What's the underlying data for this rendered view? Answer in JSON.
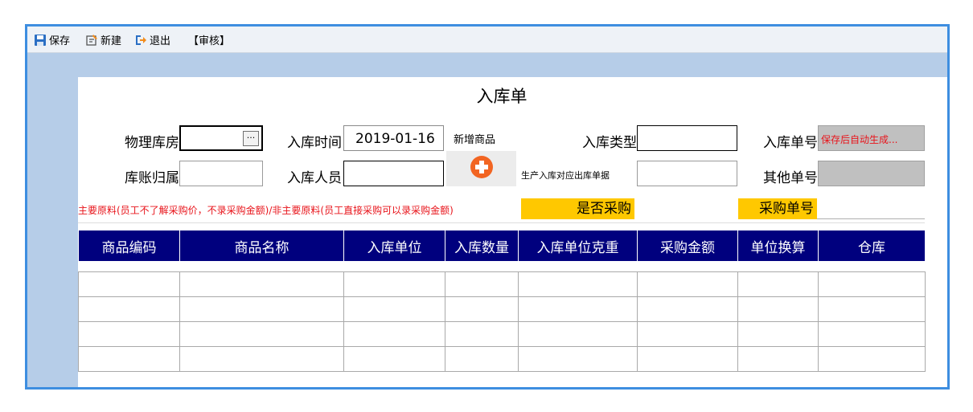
{
  "toolbar": {
    "save_label": "保存",
    "new_label": "新建",
    "exit_label": "退出",
    "audit_label": "【审核】"
  },
  "form": {
    "title": "入库单",
    "physical_warehouse_label": "物理库房",
    "physical_warehouse_value": "",
    "ellipsis_label": "···",
    "inbound_time_label": "入库时间",
    "inbound_time_value": "2019-01-16",
    "new_product_label": "新增商品",
    "inbound_type_label": "入库类型",
    "inbound_type_value": "",
    "inbound_no_label": "入库单号",
    "inbound_no_value": "保存后自动生成...",
    "ledger_owner_label": "库账归属",
    "ledger_owner_value": "",
    "inbound_person_label": "入库人员",
    "inbound_person_value": "",
    "production_ref_label": "生产入库对应出库单据",
    "production_ref_value": "",
    "other_no_label": "其他单号",
    "other_no_value": "",
    "note": "主要原料(员工不了解采购价，不录采购金额)/非主要原料(员工直接采购可以录采购金额)",
    "is_purchase_label": "是否采购",
    "purchase_no_label": "采购单号"
  },
  "table": {
    "headers": [
      "商品编码",
      "商品名称",
      "入库单位",
      "入库数量",
      "入库单位克重",
      "采购金额",
      "单位换算",
      "仓库"
    ],
    "rows": [
      [
        "",
        "",
        "",
        "",
        "",
        "",
        "",
        ""
      ],
      [
        "",
        "",
        "",
        "",
        "",
        "",
        "",
        ""
      ],
      [
        "",
        "",
        "",
        "",
        "",
        "",
        "",
        ""
      ],
      [
        "",
        "",
        "",
        "",
        "",
        "",
        "",
        ""
      ]
    ]
  },
  "colors": {
    "frame": "#3e8ee0",
    "band": "#b6cde8",
    "header_bg": "#00007e",
    "highlight": "#ffc800",
    "note": "#e8141b",
    "add_button": "#f26522"
  }
}
